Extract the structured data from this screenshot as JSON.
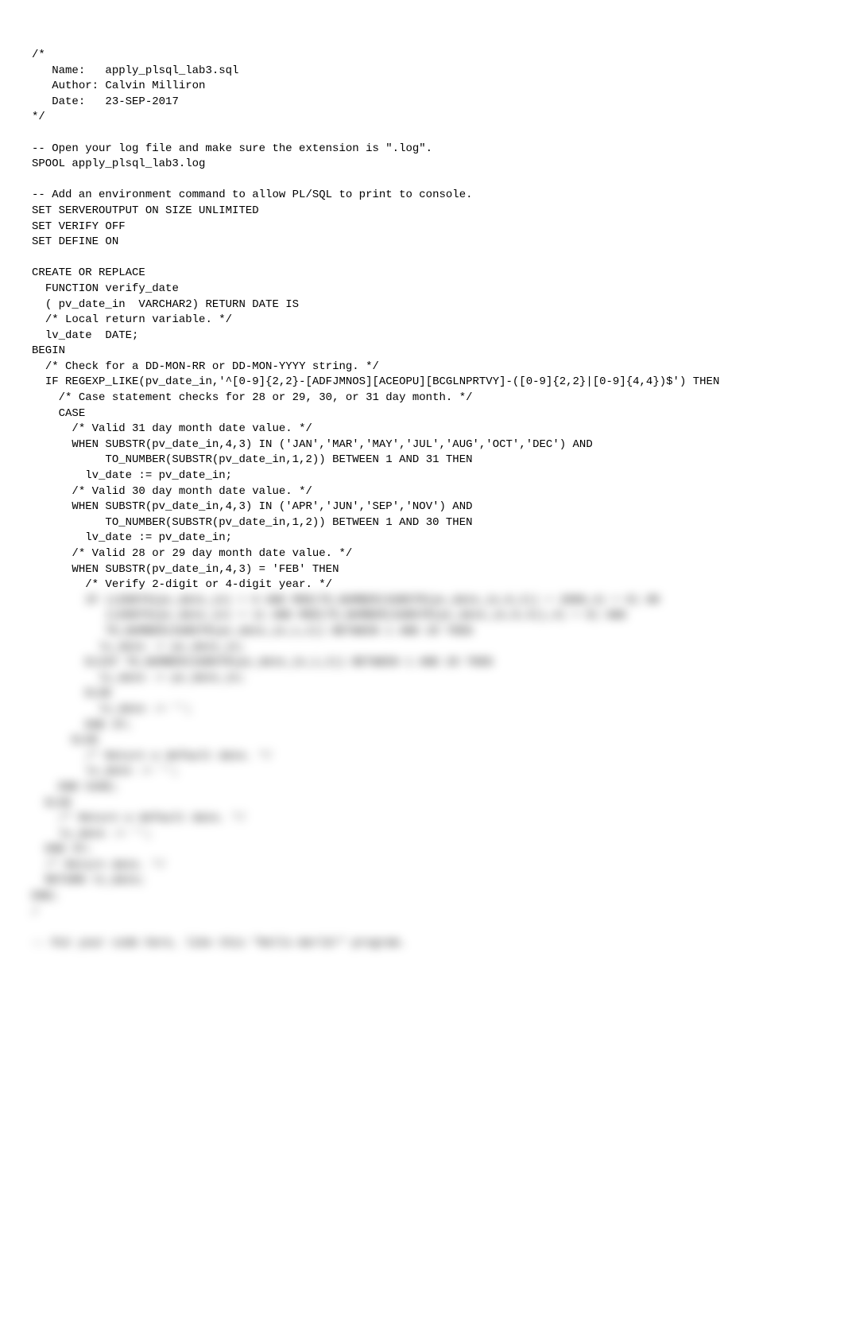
{
  "code": {
    "header": "/*\n   Name:   apply_plsql_lab3.sql\n   Author: Calvin Milliron\n   Date:   23-SEP-2017\n*/",
    "open_log_comment": "-- Open your log file and make sure the extension is \".log\".",
    "spool": "SPOOL apply_plsql_lab3.log",
    "env_comment": "-- Add an environment command to allow PL/SQL to print to console.",
    "set1": "SET SERVEROUTPUT ON SIZE UNLIMITED",
    "set2": "SET VERIFY OFF",
    "set3": "SET DEFINE ON",
    "create": "CREATE OR REPLACE",
    "func": "  FUNCTION verify_date",
    "param": "  ( pv_date_in  VARCHAR2) RETURN DATE IS",
    "local_comment": "  /* Local return variable. */",
    "local_var": "  lv_date  DATE;",
    "begin": "BEGIN",
    "check_comment": "  /* Check for a DD-MON-RR or DD-MON-YYYY string. */",
    "regexp_line": "  IF REGEXP_LIKE(pv_date_in,'^[0-9]{2,2}-[ADFJMNOS][ACEOPU][BCGLNPRTVY]-([0-9]{2,2}|[0-9]{4,4})$') THEN",
    "case_comment": "    /* Case statement checks for 28 or 29, 30, or 31 day month. */",
    "case": "    CASE",
    "valid31_comment": "      /* Valid 31 day month date value. */",
    "when31": "      WHEN SUBSTR(pv_date_in,4,3) IN ('JAN','MAR','MAY','JUL','AUG','OCT','DEC') AND",
    "when31b": "           TO_NUMBER(SUBSTR(pv_date_in,1,2)) BETWEEN 1 AND 31 THEN",
    "assign31": "        lv_date := pv_date_in;",
    "valid30_comment": "      /* Valid 30 day month date value. */",
    "when30": "      WHEN SUBSTR(pv_date_in,4,3) IN ('APR','JUN','SEP','NOV') AND",
    "when30b": "           TO_NUMBER(SUBSTR(pv_date_in,1,2)) BETWEEN 1 AND 30 THEN",
    "assign30": "        lv_date := pv_date_in;",
    "valid28_comment": "      /* Valid 28 or 29 day month date value. */",
    "when28": "      WHEN SUBSTR(pv_date_in,4,3) = 'FEB' THEN",
    "verify_comment": "        /* Verify 2-digit or 4-digit year. */"
  },
  "blurred": {
    "line1": "        IF (LENGTH(pv_date_in) = 9 AND MOD(TO_NUMBER(SUBSTR(pv_date_in,8,2)) + 2000,4) = 0) OR",
    "line2": "           (LENGTH(pv_date_in) = 11 AND MOD(TO_NUMBER(SUBSTR(pv_date_in,8,4)),4) = 0) AND",
    "line3": "           TO_NUMBER(SUBSTR(pv_date_in,1,2)) BETWEEN 1 AND 29 THEN",
    "line3b": "          lv_date := pv_date_in;",
    "line4": "        ELSIF TO_NUMBER(SUBSTR(pv_date_in,1,2)) BETWEEN 1 AND 28 THEN",
    "line4b": "          lv_date := pv_date_in;",
    "line5": "        ELSE",
    "line6": "          lv_date := '';",
    "line7": "        END IF;",
    "line8": "      ELSE",
    "line9": "        /* Return a default date. */",
    "line10": "        lv_date := '';",
    "line11": "    END CASE;",
    "line12": "  ELSE",
    "line13": "    /* Return a default date. */",
    "line14": "    lv_date := '';",
    "line15": "  END IF;",
    "line16": "  /* Return date. */",
    "line17": "  RETURN lv_date;",
    "line18": "END;",
    "line19": "/",
    "footer_comment": "-- Put your code here, like this \"Hello World!\" program."
  }
}
